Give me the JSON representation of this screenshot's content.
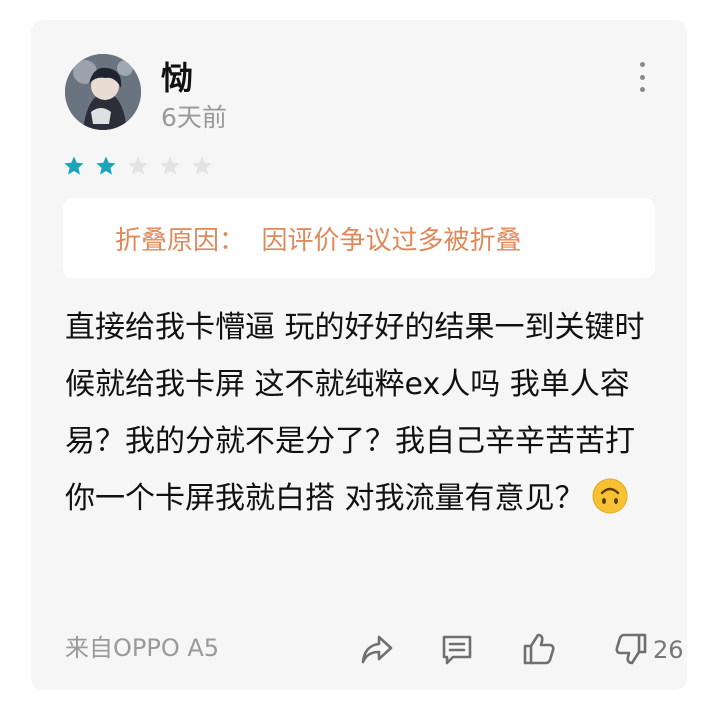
{
  "review": {
    "username": "恸",
    "time": "6天前",
    "rating": 2,
    "rating_max": 5,
    "fold_notice": "折叠原因：  因评价争议过多被折叠",
    "body_text": "直接给我卡懵逼 玩的好好的结果一到关键时候就给我卡屏 这不就纯粹ex人吗 我单人容易？我的分就不是分了？我自己辛辛苦苦打 你一个卡屏我就白搭 对我流量有意见？",
    "emoji_icon": "upside-down-face-icon",
    "source": "来自OPPO A5",
    "dislike_count": "26"
  },
  "colors": {
    "card_bg": "#f6f6f6",
    "star_active": "#17a7b8",
    "star_inactive": "#e3e3e3",
    "fold_text": "#e0895a",
    "muted": "#999999",
    "icon": "#6f6f6f"
  }
}
